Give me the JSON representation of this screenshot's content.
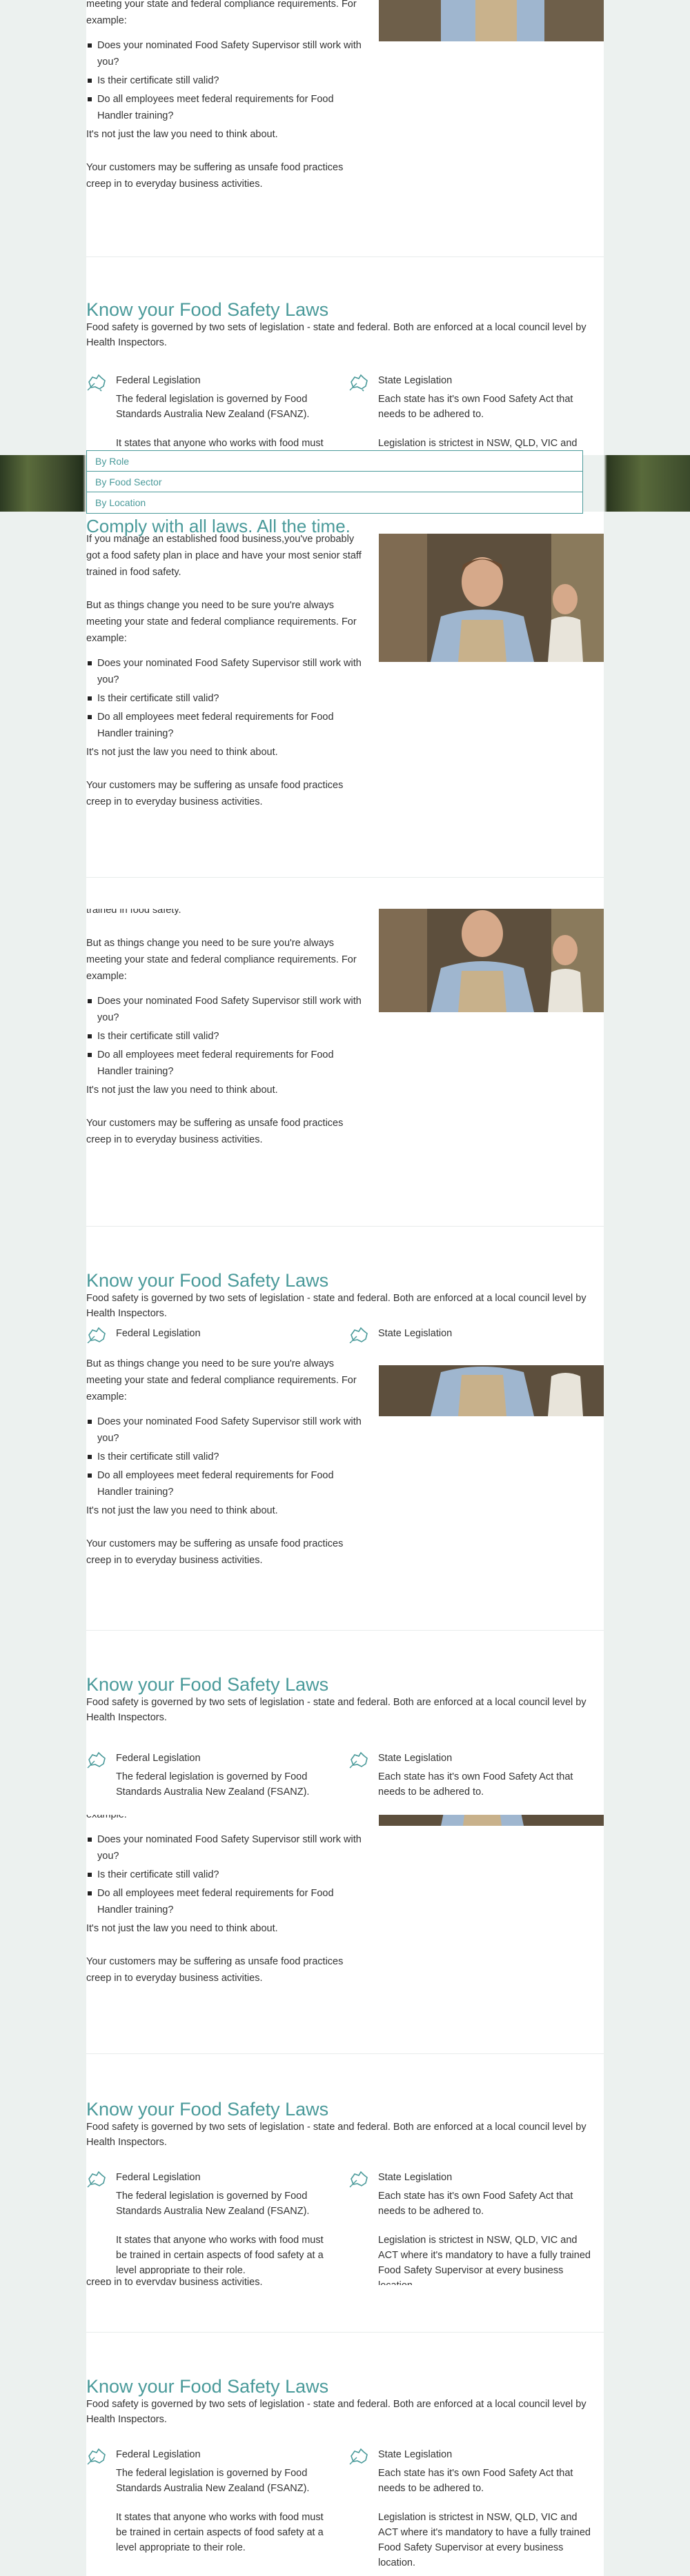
{
  "comply": {
    "title": "Comply with all laws. All the time.",
    "p1": "If you manage an established food business,you've probably got a food safety plan in place and have your most senior staff trained in food safety.",
    "p2": "But as things change you need to be sure you're always meeting your state and federal compliance requirements. For example:",
    "p2_tail": "meeting your state and federal compliance requirements. For example:",
    "p2_end": "example:",
    "p1_tail": "trained in food safety.",
    "questions": [
      "Does your nominated Food Safety Supervisor still work with you?",
      "Is their certificate still valid?",
      "Do all employees meet federal requirements for Food Handler training?"
    ],
    "p3": "It's not just the law you need to think about.",
    "p4": "Your customers may be suffering as unsafe food practices creep in to everyday business activities.",
    "p4_tail": "creep in to everyday business activities."
  },
  "laws": {
    "title": "Know your Food Safety Laws",
    "intro": "Food safety is governed by two sets of legislation - state and federal. Both are enforced at a local council level by Health Inspectors.",
    "federal": {
      "label": "Federal Legislation",
      "p1": "The federal legislation is governed by Food Standards Australia New Zealand (FSANZ).",
      "p2": "It states that anyone who works with food must be trained in certain aspects of food safety at a level appropriate to their role.",
      "p2_clip": "It states that anyone who works with food must"
    },
    "state": {
      "label": "State Legislation",
      "p1": "Each state has it's own Food Safety Act that needs to be adhered to.",
      "p2": "Legislation is strictest in NSW, QLD, VIC and ACT where it's mandatory to have a fully trained Food Safety Supervisor at every business location.",
      "p2_clip": "Legislation is strictest in NSW, QLD, VIC and"
    }
  },
  "dropdown": {
    "options": [
      "By Role",
      "By Food Sector",
      "By Location"
    ]
  },
  "colors": {
    "accent": "#4a9a9a",
    "background": "#ecf1ef"
  }
}
